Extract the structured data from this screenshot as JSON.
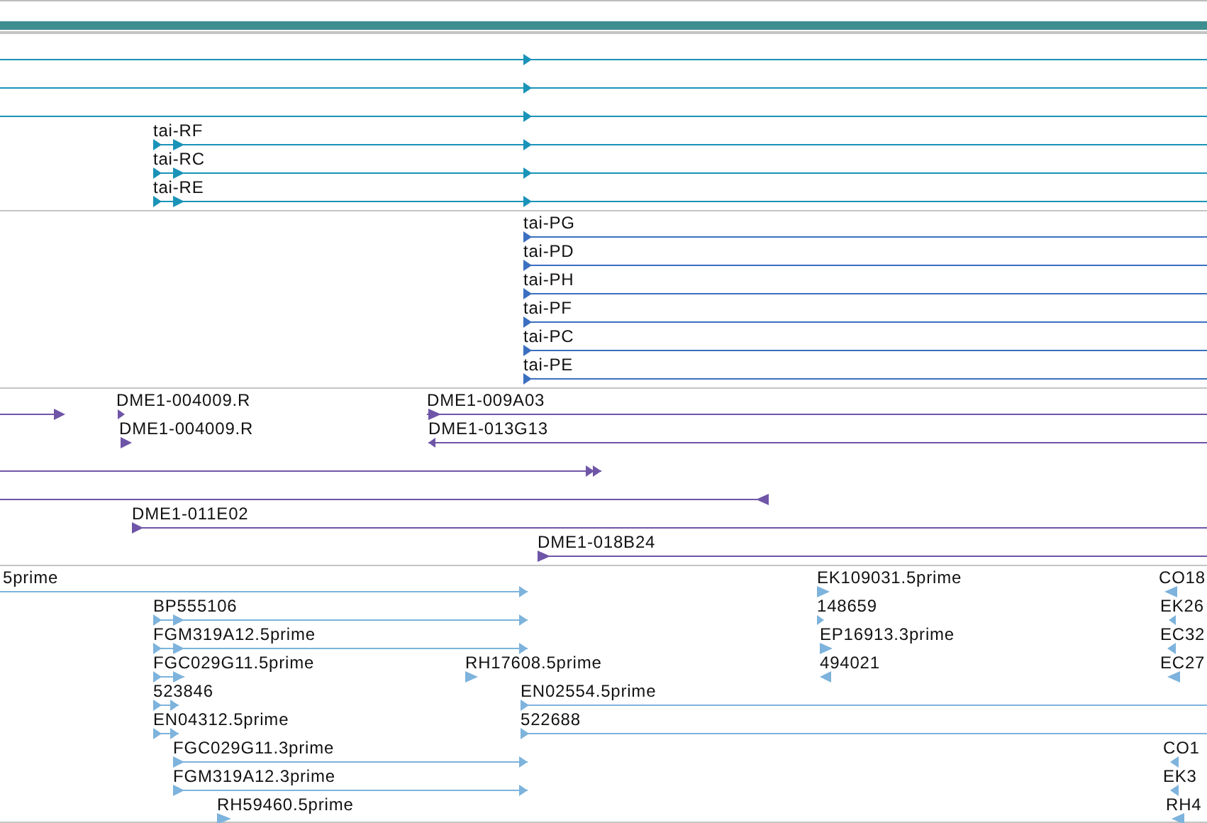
{
  "tracks": [
    {
      "color": "#1a93b8",
      "features": [
        {
          "reverse": false
        },
        {
          "reverse": false
        },
        {
          "reverse": false
        },
        {
          "label": "tai-RF",
          "reverse": false
        },
        {
          "label": "tai-RC",
          "reverse": false
        },
        {
          "label": "tai-RE",
          "reverse": false
        }
      ]
    },
    {
      "color": "#3b6fc0",
      "features": [
        {
          "label": "tai-PG",
          "reverse": false
        },
        {
          "label": "tai-PD",
          "reverse": false
        },
        {
          "label": "tai-PH",
          "reverse": false
        },
        {
          "label": "tai-PF",
          "reverse": false
        },
        {
          "label": "tai-PC",
          "reverse": false
        },
        {
          "label": "tai-PE",
          "reverse": false
        }
      ]
    },
    {
      "color": "#6f55a8",
      "features": [
        {
          "reverse": false
        },
        {
          "label": "DME1-004009.R",
          "reverse": false
        },
        {
          "label": "DME1-009A03",
          "reverse": false
        },
        {
          "label": "DME1-004009.R",
          "reverse": false
        },
        {
          "label": "DME1-013G13",
          "reverse": true
        },
        {
          "reverse": false
        },
        {
          "reverse": true
        },
        {
          "label": "DME1-011E02",
          "reverse": false
        },
        {
          "label": "DME1-018B24",
          "reverse": false
        }
      ]
    },
    {
      "color": "#7db3dc",
      "features": [
        {
          "label": "5prime",
          "reverse": false
        },
        {
          "label": "EK109031.5prime",
          "reverse": false
        },
        {
          "label": "CO18",
          "reverse": true
        },
        {
          "label": "BP555106",
          "reverse": false
        },
        {
          "label": "148659",
          "reverse": false
        },
        {
          "label": "EK26",
          "reverse": true
        },
        {
          "label": "FGM319A12.5prime",
          "reverse": false
        },
        {
          "label": "EP16913.3prime",
          "reverse": false
        },
        {
          "label": "EC32",
          "reverse": true
        },
        {
          "label": "FGC029G11.5prime",
          "reverse": false
        },
        {
          "label": "RH17608.5prime",
          "reverse": false
        },
        {
          "label": "494021",
          "reverse": true
        },
        {
          "label": "EC27",
          "reverse": true
        },
        {
          "label": "523846",
          "reverse": false
        },
        {
          "label": "EN02554.5prime",
          "reverse": false
        },
        {
          "label": "EN04312.5prime",
          "reverse": false
        },
        {
          "label": "522688",
          "reverse": false
        },
        {
          "label": "FGC029G11.3prime",
          "reverse": false
        },
        {
          "label": "CO1",
          "reverse": true
        },
        {
          "label": "FGM319A12.3prime",
          "reverse": false
        },
        {
          "label": "EK3",
          "reverse": true
        },
        {
          "label": "RH59460.5prime",
          "reverse": false
        },
        {
          "label": "RH4",
          "reverse": true
        }
      ]
    }
  ]
}
